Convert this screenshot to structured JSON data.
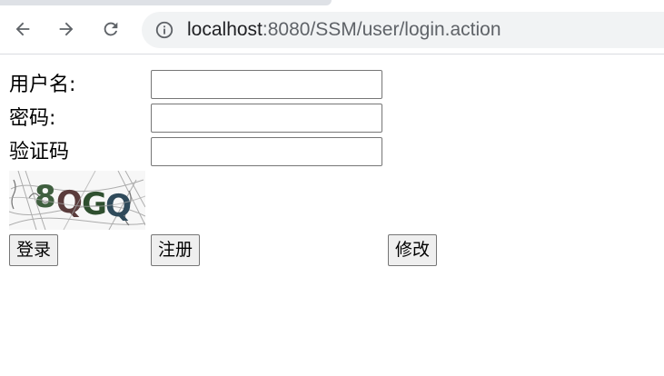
{
  "browser": {
    "url_host": "localhost",
    "url_rest": ":8080/SSM/user/login.action"
  },
  "form": {
    "username_label": "用户名:",
    "password_label": "密码:",
    "captcha_label": "验证码",
    "username_value": "",
    "password_value": "",
    "captcha_value": "",
    "captcha_text": "8QGQ"
  },
  "buttons": {
    "login": "登录",
    "register": "注册",
    "modify": "修改"
  }
}
